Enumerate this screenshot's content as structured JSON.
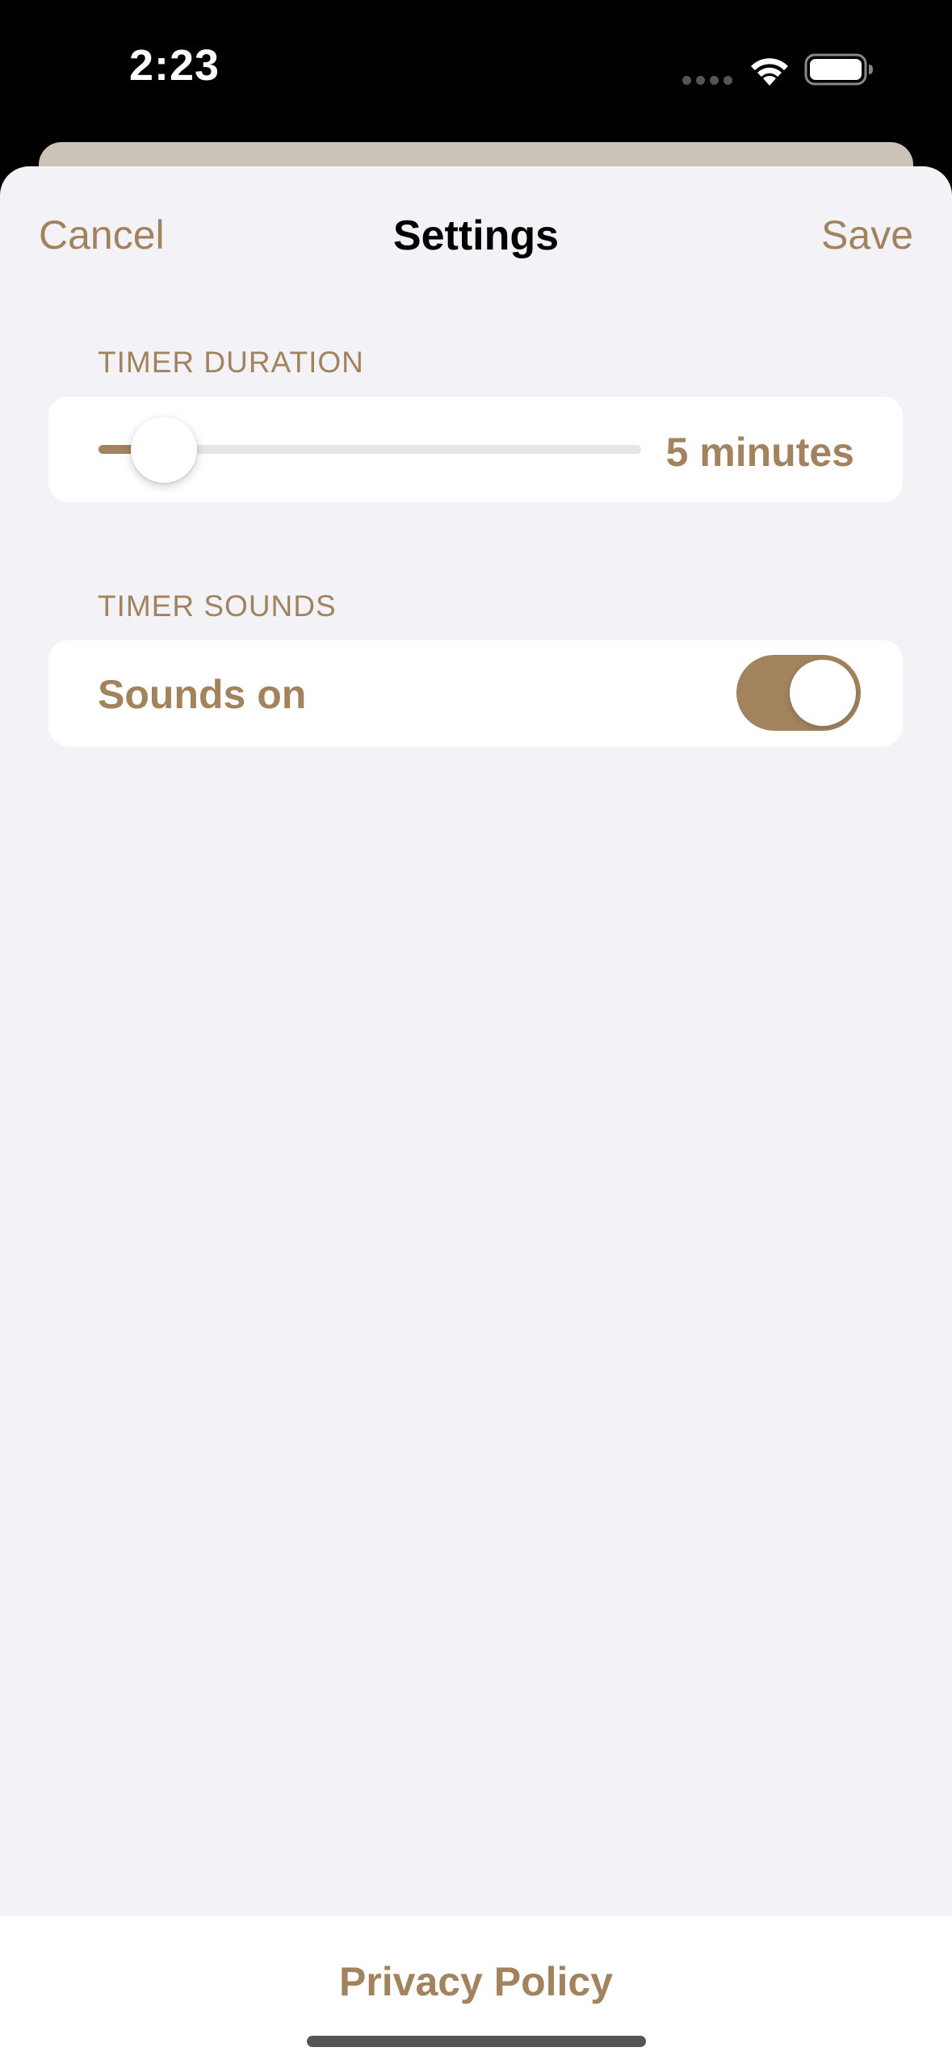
{
  "status_bar": {
    "time": "2:23",
    "icons": [
      "signal-dots-icon",
      "wifi-icon",
      "battery-icon"
    ]
  },
  "nav": {
    "cancel_label": "Cancel",
    "title": "Settings",
    "save_label": "Save"
  },
  "timer_duration": {
    "header": "TIMER DURATION",
    "value_label": "5 minutes",
    "slider_fraction": 0.12
  },
  "timer_sounds": {
    "header": "TIMER SOUNDS",
    "toggle_label": "Sounds on",
    "toggle_on": true
  },
  "footer": {
    "privacy_label": "Privacy Policy"
  },
  "colors": {
    "accent": "#a2835e",
    "background": "#f2f2f7",
    "card": "#ffffff",
    "back_sheet": "#cbc3b8"
  }
}
